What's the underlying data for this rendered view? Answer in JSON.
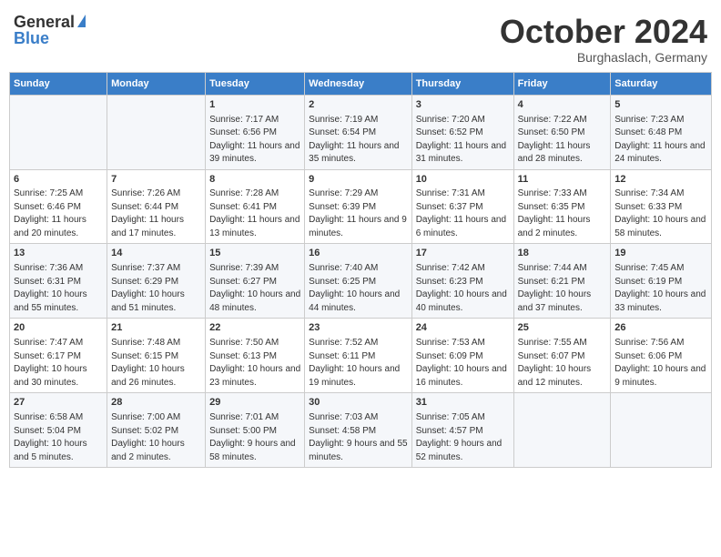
{
  "header": {
    "logo_general": "General",
    "logo_blue": "Blue",
    "month_year": "October 2024",
    "location": "Burghaslach, Germany"
  },
  "columns": [
    "Sunday",
    "Monday",
    "Tuesday",
    "Wednesday",
    "Thursday",
    "Friday",
    "Saturday"
  ],
  "weeks": [
    [
      {
        "day": "",
        "info": ""
      },
      {
        "day": "",
        "info": ""
      },
      {
        "day": "1",
        "info": "Sunrise: 7:17 AM\nSunset: 6:56 PM\nDaylight: 11 hours and 39 minutes."
      },
      {
        "day": "2",
        "info": "Sunrise: 7:19 AM\nSunset: 6:54 PM\nDaylight: 11 hours and 35 minutes."
      },
      {
        "day": "3",
        "info": "Sunrise: 7:20 AM\nSunset: 6:52 PM\nDaylight: 11 hours and 31 minutes."
      },
      {
        "day": "4",
        "info": "Sunrise: 7:22 AM\nSunset: 6:50 PM\nDaylight: 11 hours and 28 minutes."
      },
      {
        "day": "5",
        "info": "Sunrise: 7:23 AM\nSunset: 6:48 PM\nDaylight: 11 hours and 24 minutes."
      }
    ],
    [
      {
        "day": "6",
        "info": "Sunrise: 7:25 AM\nSunset: 6:46 PM\nDaylight: 11 hours and 20 minutes."
      },
      {
        "day": "7",
        "info": "Sunrise: 7:26 AM\nSunset: 6:44 PM\nDaylight: 11 hours and 17 minutes."
      },
      {
        "day": "8",
        "info": "Sunrise: 7:28 AM\nSunset: 6:41 PM\nDaylight: 11 hours and 13 minutes."
      },
      {
        "day": "9",
        "info": "Sunrise: 7:29 AM\nSunset: 6:39 PM\nDaylight: 11 hours and 9 minutes."
      },
      {
        "day": "10",
        "info": "Sunrise: 7:31 AM\nSunset: 6:37 PM\nDaylight: 11 hours and 6 minutes."
      },
      {
        "day": "11",
        "info": "Sunrise: 7:33 AM\nSunset: 6:35 PM\nDaylight: 11 hours and 2 minutes."
      },
      {
        "day": "12",
        "info": "Sunrise: 7:34 AM\nSunset: 6:33 PM\nDaylight: 10 hours and 58 minutes."
      }
    ],
    [
      {
        "day": "13",
        "info": "Sunrise: 7:36 AM\nSunset: 6:31 PM\nDaylight: 10 hours and 55 minutes."
      },
      {
        "day": "14",
        "info": "Sunrise: 7:37 AM\nSunset: 6:29 PM\nDaylight: 10 hours and 51 minutes."
      },
      {
        "day": "15",
        "info": "Sunrise: 7:39 AM\nSunset: 6:27 PM\nDaylight: 10 hours and 48 minutes."
      },
      {
        "day": "16",
        "info": "Sunrise: 7:40 AM\nSunset: 6:25 PM\nDaylight: 10 hours and 44 minutes."
      },
      {
        "day": "17",
        "info": "Sunrise: 7:42 AM\nSunset: 6:23 PM\nDaylight: 10 hours and 40 minutes."
      },
      {
        "day": "18",
        "info": "Sunrise: 7:44 AM\nSunset: 6:21 PM\nDaylight: 10 hours and 37 minutes."
      },
      {
        "day": "19",
        "info": "Sunrise: 7:45 AM\nSunset: 6:19 PM\nDaylight: 10 hours and 33 minutes."
      }
    ],
    [
      {
        "day": "20",
        "info": "Sunrise: 7:47 AM\nSunset: 6:17 PM\nDaylight: 10 hours and 30 minutes."
      },
      {
        "day": "21",
        "info": "Sunrise: 7:48 AM\nSunset: 6:15 PM\nDaylight: 10 hours and 26 minutes."
      },
      {
        "day": "22",
        "info": "Sunrise: 7:50 AM\nSunset: 6:13 PM\nDaylight: 10 hours and 23 minutes."
      },
      {
        "day": "23",
        "info": "Sunrise: 7:52 AM\nSunset: 6:11 PM\nDaylight: 10 hours and 19 minutes."
      },
      {
        "day": "24",
        "info": "Sunrise: 7:53 AM\nSunset: 6:09 PM\nDaylight: 10 hours and 16 minutes."
      },
      {
        "day": "25",
        "info": "Sunrise: 7:55 AM\nSunset: 6:07 PM\nDaylight: 10 hours and 12 minutes."
      },
      {
        "day": "26",
        "info": "Sunrise: 7:56 AM\nSunset: 6:06 PM\nDaylight: 10 hours and 9 minutes."
      }
    ],
    [
      {
        "day": "27",
        "info": "Sunrise: 6:58 AM\nSunset: 5:04 PM\nDaylight: 10 hours and 5 minutes."
      },
      {
        "day": "28",
        "info": "Sunrise: 7:00 AM\nSunset: 5:02 PM\nDaylight: 10 hours and 2 minutes."
      },
      {
        "day": "29",
        "info": "Sunrise: 7:01 AM\nSunset: 5:00 PM\nDaylight: 9 hours and 58 minutes."
      },
      {
        "day": "30",
        "info": "Sunrise: 7:03 AM\nSunset: 4:58 PM\nDaylight: 9 hours and 55 minutes."
      },
      {
        "day": "31",
        "info": "Sunrise: 7:05 AM\nSunset: 4:57 PM\nDaylight: 9 hours and 52 minutes."
      },
      {
        "day": "",
        "info": ""
      },
      {
        "day": "",
        "info": ""
      }
    ]
  ]
}
